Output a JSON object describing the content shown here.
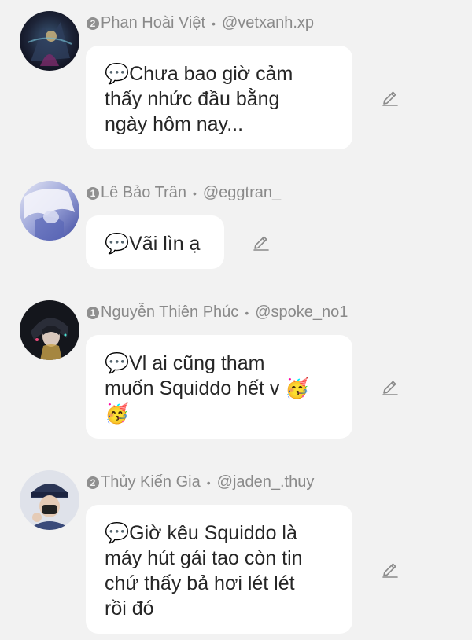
{
  "comments": [
    {
      "rank": "2",
      "name": "Phan Hoài Việt",
      "handle": "@vetxanh.xp",
      "text": "💬Chưa bao giờ cảm\nthấy nhức đầu bằng\nngày hôm nay...",
      "avatar": "dark-fantasy-avatar"
    },
    {
      "rank": "1",
      "name": "Lê Bảo Trân",
      "handle": "@eggtran_",
      "text": "💬Vãi lìn ạ",
      "avatar": "white-hair-anime-avatar"
    },
    {
      "rank": "1",
      "name": "Nguyễn Thiên Phúc",
      "handle": "@spoke_no1",
      "text": "💬Vl ai cũng tham\nmuốn Squiddo hết v 🥳\n🥳",
      "avatar": "dark-anime-avatar"
    },
    {
      "rank": "2",
      "name": "Thủy Kiến Gia",
      "handle": "@jaden_.thuy",
      "text": "💬Giờ kêu Squiddo là\nmáy hút gái tao còn tin\nchứ thấy bả hơi lét lét\nrồi đó",
      "avatar": "masked-person-avatar"
    }
  ],
  "icons": {
    "edit": "pencil-icon"
  },
  "colors": {
    "background": "#f2f2f2",
    "bubble": "#ffffff",
    "meta_text": "#8a8a8a",
    "body_text": "#262626"
  }
}
